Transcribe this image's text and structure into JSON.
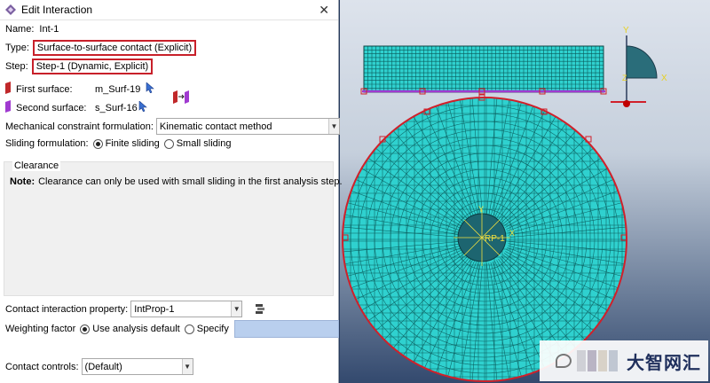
{
  "dialog": {
    "title": "Edit Interaction",
    "close_symbol": "✕",
    "name_label": "Name:",
    "name_value": "Int-1",
    "type_label": "Type:",
    "type_value": "Surface-to-surface contact (Explicit)",
    "step_label": "Step:",
    "step_value": "Step-1 (Dynamic, Explicit)",
    "first_surface_label": "First surface:",
    "first_surface_value": "m_Surf-19",
    "second_surface_label": "Second surface:",
    "second_surface_value": "s_Surf-16",
    "mech_label": "Mechanical constraint formulation:",
    "mech_value": "Kinematic contact method",
    "sliding_label": "Sliding formulation:",
    "sliding_options": [
      "Finite sliding",
      "Small sliding"
    ],
    "sliding_selected": "Finite sliding",
    "clearance_title": "Clearance",
    "clearance_note_label": "Note:",
    "clearance_note_text": "Clearance can only be used with small sliding in the first analysis step.",
    "property_label": "Contact interaction property:",
    "property_value": "IntProp-1",
    "weighting_label": "Weighting factor",
    "weighting_options": [
      "Use analysis default",
      "Specify"
    ],
    "weighting_selected": "Use analysis default",
    "controls_label": "Contact controls:",
    "controls_value": "(Default)"
  },
  "viewport": {
    "axis_y": "Y",
    "axis_x": "X",
    "axis_z": "Z",
    "rp_label": "RP-1",
    "mesh_color": "#2fd1cf",
    "outline_color": "#d0202a"
  },
  "watermark": {
    "text": "大智网汇"
  },
  "icons": [
    "edit-interaction-icon",
    "surface-icon",
    "pick-arrow-icon",
    "swap-surfaces-icon",
    "property-manager-icon",
    "chevron-down-icon"
  ]
}
